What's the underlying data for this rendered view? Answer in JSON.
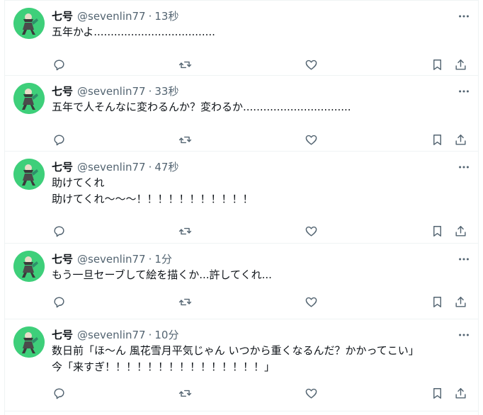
{
  "tweets": [
    {
      "display_name": "七号",
      "handle": "@sevenlin77",
      "time": "13秒",
      "text": "五年かよ...................................."
    },
    {
      "display_name": "七号",
      "handle": "@sevenlin77",
      "time": "33秒",
      "text": "五年で人そんなに変わるんか？変わるか................................"
    },
    {
      "display_name": "七号",
      "handle": "@sevenlin77",
      "time": "47秒",
      "text": "助けてくれ\n助けてくれ〜〜〜！！！！！！！！！！！"
    },
    {
      "display_name": "七号",
      "handle": "@sevenlin77",
      "time": "1分",
      "text": "もう一旦セーブして絵を描くか...許してくれ..."
    },
    {
      "display_name": "七号",
      "handle": "@sevenlin77",
      "time": "10分",
      "text": "数日前「ほ〜ん 風花雪月平気じゃん いつから重くなるんだ？かかってこい」\n今「来すぎ！！！！！！！！！！！！！！！」"
    }
  ],
  "colors": {
    "icon": "#536471",
    "text": "#0f1419",
    "avatar_bg": "#3ecf7a",
    "border": "#eff3f4"
  },
  "separator": "·"
}
